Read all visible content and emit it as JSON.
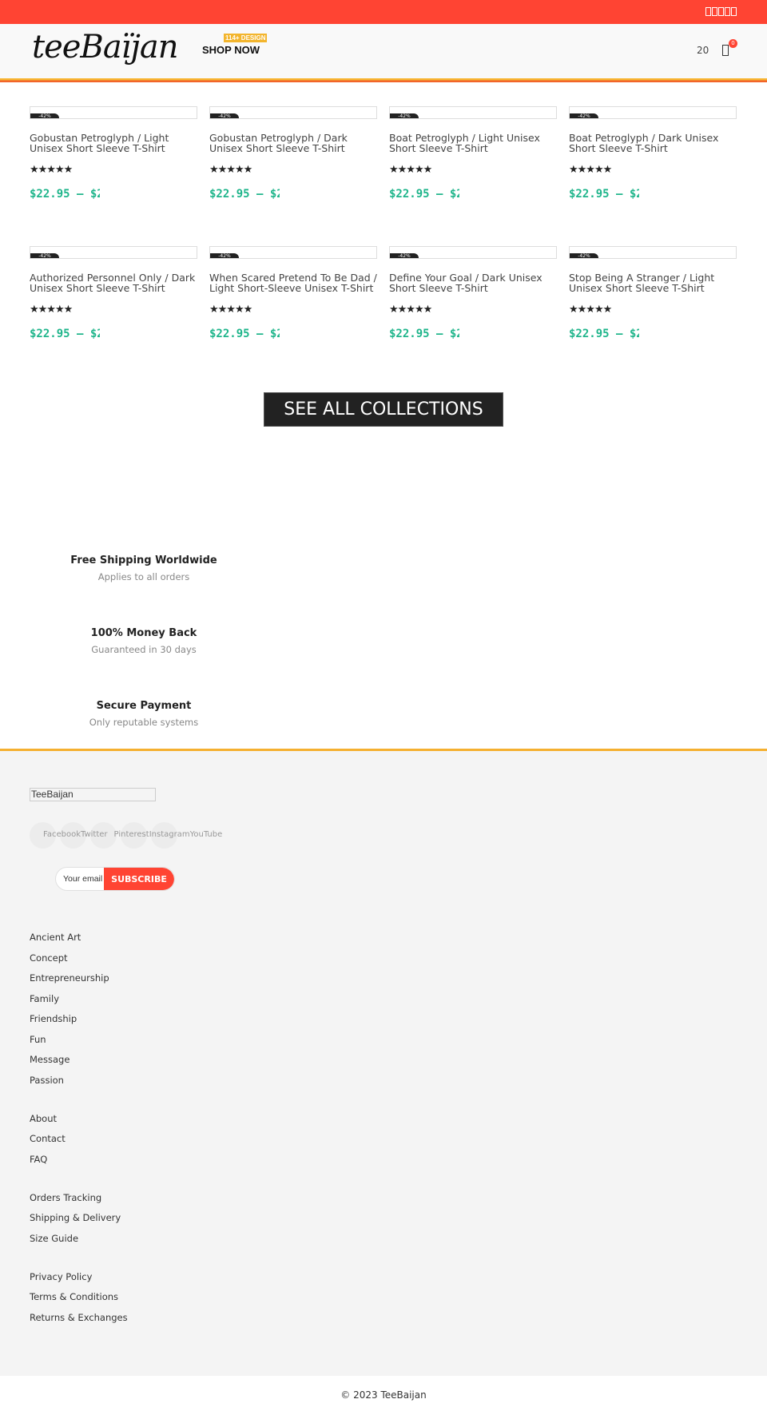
{
  "topbar": {
    "icons": [
      "facebook-icon",
      "twitter-icon",
      "pinterest-icon",
      "instagram-icon",
      "youtube-icon"
    ]
  },
  "header": {
    "logo": "teeBaïjan",
    "shop_now": "SHOP NOW",
    "design_badge": "114+ DESIGN",
    "compare_count": "20",
    "cart_count": "0"
  },
  "products": [
    {
      "title": "Gobustan Petroglyph / Light Unisex Short Sleeve T-Shirt",
      "rating": 5,
      "price": "$22.95 – $2",
      "badge": "-42%"
    },
    {
      "title": "Gobustan Petroglyph / Dark Unisex Short Sleeve T-Shirt",
      "rating": 5,
      "price": "$22.95 – $2",
      "badge": "-42%"
    },
    {
      "title": "Boat Petroglyph / Light Unisex Short Sleeve T-Shirt",
      "rating": 5,
      "price": "$22.95 – $2",
      "badge": "-42%"
    },
    {
      "title": "Boat Petroglyph / Dark Unisex Short Sleeve T-Shirt",
      "rating": 5,
      "price": "$22.95 – $2",
      "badge": "-42%"
    },
    {
      "title": "Authorized Personnel Only / Dark Unisex Short Sleeve T-Shirt",
      "rating": 5,
      "price": "$22.95 – $2",
      "badge": "-42%"
    },
    {
      "title": "When Scared Pretend To Be Dad / Light Short-Sleeve Unisex T-Shirt",
      "rating": 5,
      "price": "$22.95 – $2",
      "badge": "-42%"
    },
    {
      "title": "Define Your Goal / Dark Unisex Short Sleeve T-Shirt",
      "rating": 5,
      "price": "$22.95 – $2",
      "badge": "-42%"
    },
    {
      "title": "Stop Being A Stranger / Light Unisex Short Sleeve T-Shirt",
      "rating": 5,
      "price": "$22.95 – $2",
      "badge": "-42%"
    }
  ],
  "see_all": "SEE ALL COLLECTIONS",
  "features": [
    {
      "title": "Free Shipping Worldwide",
      "subtitle": "Applies to all orders"
    },
    {
      "title": "100% Money Back",
      "subtitle": "Guaranteed in 30 days"
    },
    {
      "title": "Secure Payment",
      "subtitle": "Only reputable systems"
    }
  ],
  "footer": {
    "logo": "TeeBaijan",
    "social": [
      "Facebook",
      "Twitter",
      "Pinterest",
      "Instagram",
      "YouTube"
    ],
    "email_placeholder": "Your email",
    "subscribe": "SUBSCRIBE",
    "link_groups": [
      [
        "Ancient Art",
        "Concept",
        "Entrepreneurship",
        "Family",
        "Friendship",
        "Fun",
        "Message",
        "Passion"
      ],
      [
        "About",
        "Contact",
        "FAQ"
      ],
      [
        "Orders Tracking",
        "Shipping & Delivery",
        "Size Guide"
      ],
      [
        "Privacy Policy",
        "Terms & Conditions",
        "Returns & Exchanges"
      ]
    ],
    "copyright": "© 2023 TeeBaijan"
  },
  "colors": {
    "accent": "#ff4433",
    "price": "#1fb58b",
    "stripe": "#f5b030"
  }
}
